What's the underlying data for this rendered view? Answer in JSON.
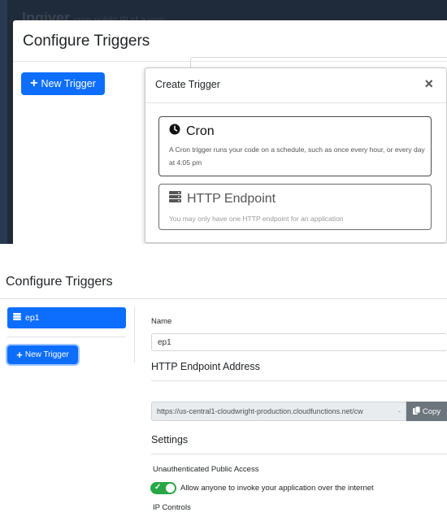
{
  "background": {
    "page_title": "Ingiver",
    "page_subtitle": "cron public IP of a vpm"
  },
  "config_modal": {
    "title": "Configure Triggers",
    "new_trigger_label": "New Trigger"
  },
  "create_modal": {
    "title": "Create Trigger",
    "close_label": "×",
    "options": [
      {
        "title": "Cron",
        "icon": "clock-icon",
        "description": "A Cron trigger runs your code on a schedule, such as once every hour, or every day at 4:05 pm"
      },
      {
        "title": "HTTP Endpoint",
        "icon": "server-icon",
        "description": "You may only have one HTTP endpoint for an application"
      }
    ]
  },
  "page": {
    "title": "Configure Triggers",
    "sidebar_items": [
      {
        "label": "ep1",
        "icon": "server-icon"
      }
    ],
    "new_trigger_label": "New Trigger",
    "name_label": "Name",
    "name_value": "ep1",
    "endpoint_heading": "HTTP Endpoint Address",
    "endpoint_url": "https://us-central1-cloudwright-production.cloudfunctions.net/cw",
    "endpoint_dash": "-",
    "copy_label": "Copy",
    "settings_heading": "Settings",
    "public_access_label": "Unauthenticated Public Access",
    "allow_anyone_label": "Allow anyone to invoke your application over the internet",
    "allow_anyone_enabled": true,
    "ip_controls_label": "IP Controls"
  },
  "colors": {
    "primary": "#0d6efd",
    "toggle_on": "#28a745",
    "copy_button": "#6c757d",
    "overlay": "#1f2b3a"
  }
}
